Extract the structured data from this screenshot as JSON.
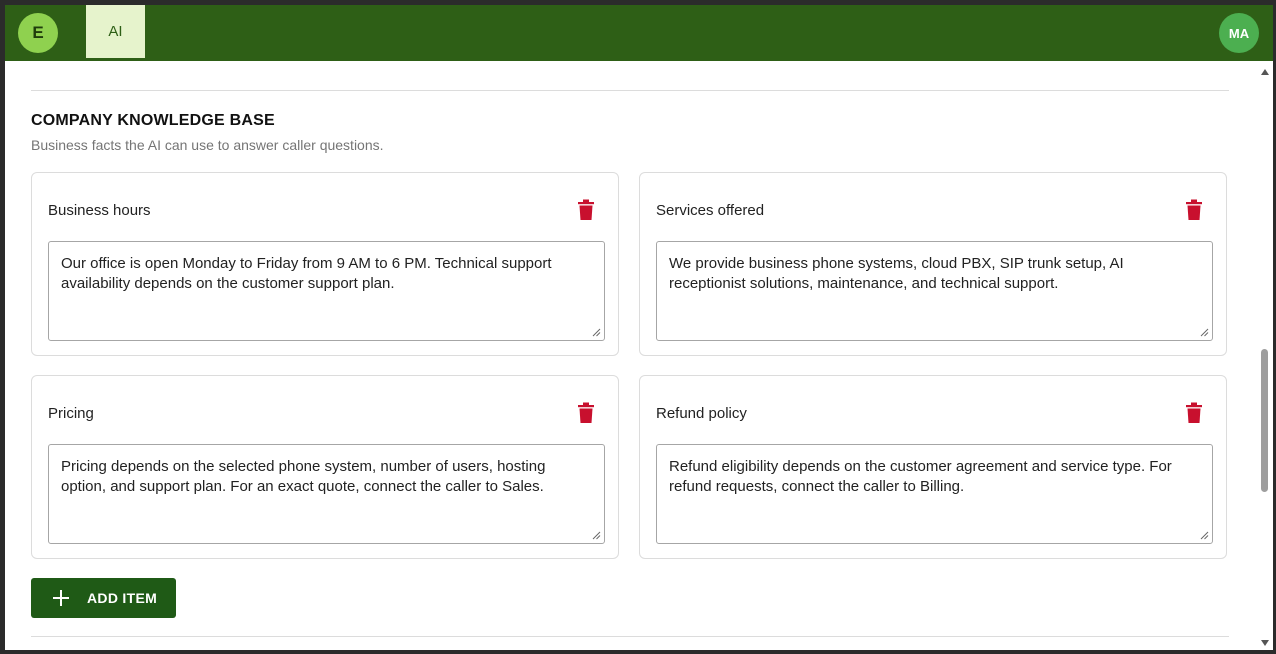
{
  "header": {
    "left_avatar": "E",
    "tab_label": "AI",
    "user_avatar": "MA"
  },
  "section": {
    "title": "COMPANY KNOWLEDGE BASE",
    "subtitle": "Business facts the AI can use to answer caller questions."
  },
  "items": [
    {
      "title": "Business hours",
      "text": "Our office is open Monday to Friday from 9 AM to 6 PM. Technical support availability depends on the customer support plan."
    },
    {
      "title": "Services offered",
      "text": "We provide business phone systems, cloud PBX, SIP trunk setup, AI receptionist solutions, maintenance, and technical support."
    },
    {
      "title": "Pricing",
      "text": "Pricing depends on the selected phone system, number of users, hosting option, and support plan. For an exact quote, connect the caller to Sales."
    },
    {
      "title": "Refund policy",
      "text": "Refund eligibility depends on the customer agreement and service type. For refund requests, connect the caller to Billing."
    }
  ],
  "add_button": {
    "label": "ADD ITEM",
    "icon": "plus-icon"
  },
  "colors": {
    "header_bg": "#2e5f16",
    "tab_active_bg": "#e6f3cc",
    "accent_button": "#1f5a16",
    "delete_icon": "#c8102e",
    "avatar_e": "#8fd14f",
    "avatar_ma": "#4caf50"
  },
  "icons": {
    "delete": "trash-icon",
    "resize": "resize-grip-icon"
  }
}
